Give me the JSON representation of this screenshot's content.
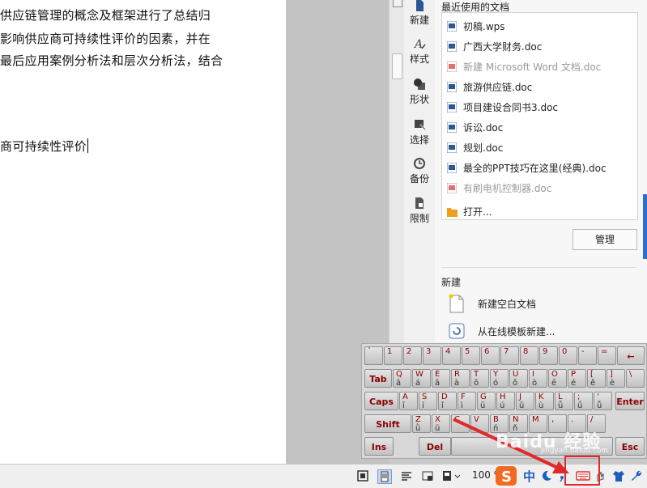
{
  "document": {
    "lines": [
      "供应链管理的概念及框架进行了总结归",
      "影响供应商可持续性评价的因素，并在",
      "最后应用案例分析法和层次分析法，结合",
      "商可持续性评价"
    ]
  },
  "side_tabs": [
    {
      "label": "新建",
      "icon": "new-doc-icon"
    },
    {
      "label": "样式",
      "icon": "style-icon"
    },
    {
      "label": "形状",
      "icon": "shape-icon"
    },
    {
      "label": "选择",
      "icon": "select-icon"
    },
    {
      "label": "备份",
      "icon": "backup-icon"
    },
    {
      "label": "限制",
      "icon": "restrict-icon"
    }
  ],
  "task_pane": {
    "recent_title": "最近使用的文档",
    "recent_files": [
      {
        "name": "初稿.wps",
        "type": "wps",
        "dim": false
      },
      {
        "name": "广西大学财务.doc",
        "type": "doc",
        "dim": false
      },
      {
        "name": "新建 Microsoft Word 文档.doc",
        "type": "doc-missing",
        "dim": true
      },
      {
        "name": "旅游供应链.doc",
        "type": "doc",
        "dim": false
      },
      {
        "name": "项目建设合同书3.doc",
        "type": "doc",
        "dim": false
      },
      {
        "name": "诉讼.doc",
        "type": "doc",
        "dim": false
      },
      {
        "name": "规划.doc",
        "type": "doc",
        "dim": false
      },
      {
        "name": "最全的PPT技巧在这里(经典).doc",
        "type": "doc",
        "dim": false
      },
      {
        "name": "有刷电机控制器.doc",
        "type": "doc-missing",
        "dim": true
      }
    ],
    "open_label": "打开...",
    "manage_label": "管理",
    "new_title": "新建",
    "new_blank_label": "新建空白文档",
    "new_online_label": "从在线模板新建..."
  },
  "keyboard": {
    "rows": [
      [
        [
          "`",
          ""
        ],
        [
          "1",
          ""
        ],
        [
          "2",
          ""
        ],
        [
          "3",
          ""
        ],
        [
          "4",
          ""
        ],
        [
          "5",
          ""
        ],
        [
          "6",
          ""
        ],
        [
          "7",
          ""
        ],
        [
          "8",
          ""
        ],
        [
          "9",
          ""
        ],
        [
          "0",
          ""
        ],
        [
          "-",
          ""
        ],
        [
          "=",
          ""
        ]
      ],
      [
        [
          "Q",
          "ā"
        ],
        [
          "W",
          "á"
        ],
        [
          "E",
          "ǎ"
        ],
        [
          "R",
          "à"
        ],
        [
          "T",
          "ō"
        ],
        [
          "Y",
          "ó"
        ],
        [
          "U",
          "ǒ"
        ],
        [
          "I",
          "ò"
        ],
        [
          "O",
          "ē"
        ],
        [
          "P",
          "é"
        ],
        [
          "[",
          "ě"
        ],
        [
          "]",
          "è"
        ],
        [
          "\\",
          ""
        ]
      ],
      [
        [
          "A",
          "ī"
        ],
        [
          "S",
          "í"
        ],
        [
          "D",
          "ǐ"
        ],
        [
          "F",
          "ì"
        ],
        [
          "G",
          "ū"
        ],
        [
          "H",
          "ú"
        ],
        [
          "J",
          "ǔ"
        ],
        [
          "K",
          "ù"
        ],
        [
          "L",
          "ǖ"
        ],
        [
          ";",
          "ǘ"
        ],
        [
          "'",
          "ǚ"
        ]
      ],
      [
        [
          "Z",
          "ǜ"
        ],
        [
          "X",
          "ü"
        ],
        [
          "C",
          ""
        ],
        [
          "V",
          ""
        ],
        [
          "B",
          "ń"
        ],
        [
          "N",
          "ň"
        ],
        [
          "M",
          ""
        ],
        [
          ",",
          ""
        ],
        [
          ".",
          ""
        ],
        [
          "/",
          ""
        ]
      ]
    ],
    "backspace_label": "←",
    "tab_label": "Tab",
    "caps_label": "Caps",
    "enter_label": "Enter",
    "shift_label": "Shift",
    "ins_label": "Ins",
    "del_label": "Del",
    "esc_label": "Esc"
  },
  "statusbar": {
    "zoom": "100 %",
    "ime_mode": "中"
  },
  "watermark": {
    "text": "Baidu 经验",
    "sub": "jingyan.baidu.com"
  },
  "colors": {
    "accent_red": "#e02a2a",
    "key_red_text": "#8b0000",
    "sogou_orange": "#f26a21",
    "word_blue": "#2b5797"
  }
}
